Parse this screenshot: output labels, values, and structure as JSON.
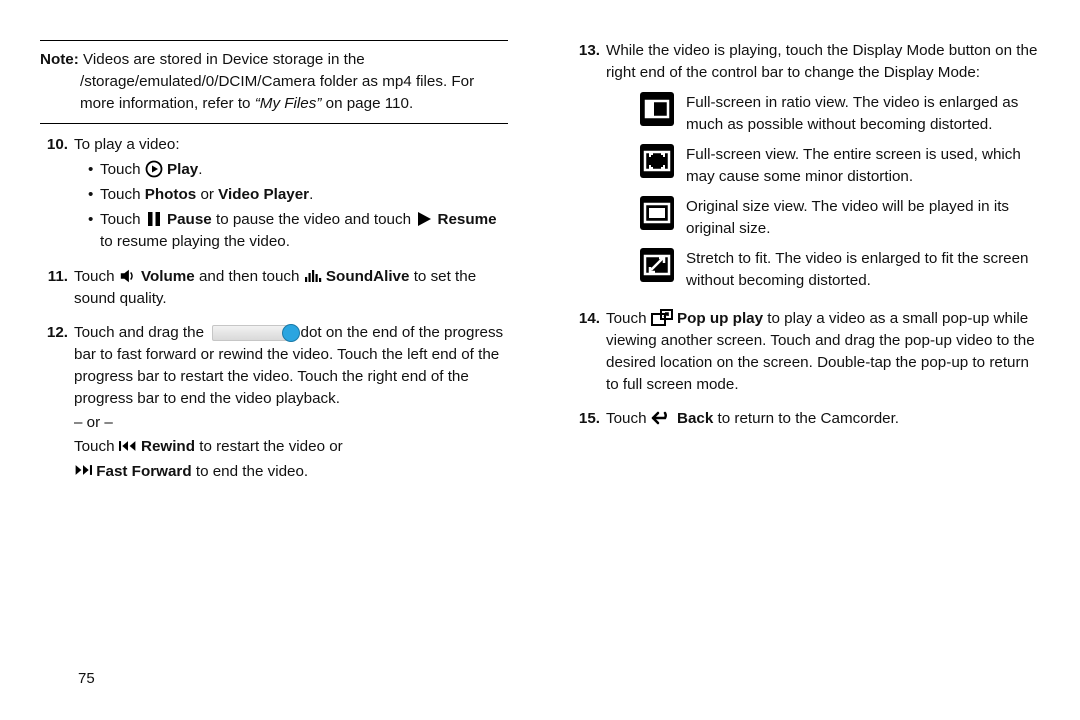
{
  "left": {
    "note_label": "Note:",
    "note_text_1": "Videos are stored in Device storage in the /storage/emulated/0/DCIM/Camera folder as mp4 files. For more information, refer to ",
    "note_link": "“My Files”",
    "note_text_2": " on page 110.",
    "step10_num": "10.",
    "step10_intro": "To play a video:",
    "step10_b1_pre": "Touch ",
    "step10_b1_label": "Play",
    "step10_b1_post": ".",
    "step10_b2_pre": "Touch ",
    "step10_b2_bold1": "Photos",
    "step10_b2_mid": " or ",
    "step10_b2_bold2": "Video Player",
    "step10_b2_post": ".",
    "step10_b3_pre": "Touch ",
    "step10_b3_bold1": "Pause",
    "step10_b3_mid": " to pause the video and touch ",
    "step10_b3_bold2": "Resume",
    "step10_b3_post": " to resume playing the video.",
    "step11_num": "11.",
    "step11_pre": "Touch ",
    "step11_bold1": "Volume",
    "step11_mid": " and then touch ",
    "step11_bold2": "SoundAlive",
    "step11_post": " to set the sound quality.",
    "step12_num": "12.",
    "step12_pre": "Touch and drag the ",
    "step12_mid": " dot on the end of the progress bar to fast forward or rewind the video. Touch the left end of the progress bar to restart the video. Touch the right end of the progress bar to end the video playback.",
    "step12_or": "– or –",
    "step12_rw_pre": "Touch ",
    "step12_rw_bold": "Rewind",
    "step12_rw_post": " to restart the video or",
    "step12_ff_bold": "Fast Forward",
    "step12_ff_post": " to end the video.",
    "page_num": "75"
  },
  "right": {
    "step13_num": "13.",
    "step13_text": "While the video is playing, touch the Display Mode button on the right end of the control bar to change the Display Mode:",
    "mode1": "Full-screen in ratio view. The video is enlarged as much as possible without becoming distorted.",
    "mode2": "Full-screen view. The entire screen is used, which may cause some minor distortion.",
    "mode3": "Original size view. The video will be played in its original size.",
    "mode4": "Stretch to fit. The video is enlarged to fit the screen without becoming distorted.",
    "step14_num": "14.",
    "step14_pre": "Touch ",
    "step14_bold": "Pop up play",
    "step14_post": " to play a video as a small pop-up while viewing another screen. Touch and drag the pop-up video to the desired location on the screen. Double-tap the pop-up to return to full screen mode.",
    "step15_num": "15.",
    "step15_pre": "Touch ",
    "step15_bold": "Back",
    "step15_post": " to return to the Camcorder."
  }
}
